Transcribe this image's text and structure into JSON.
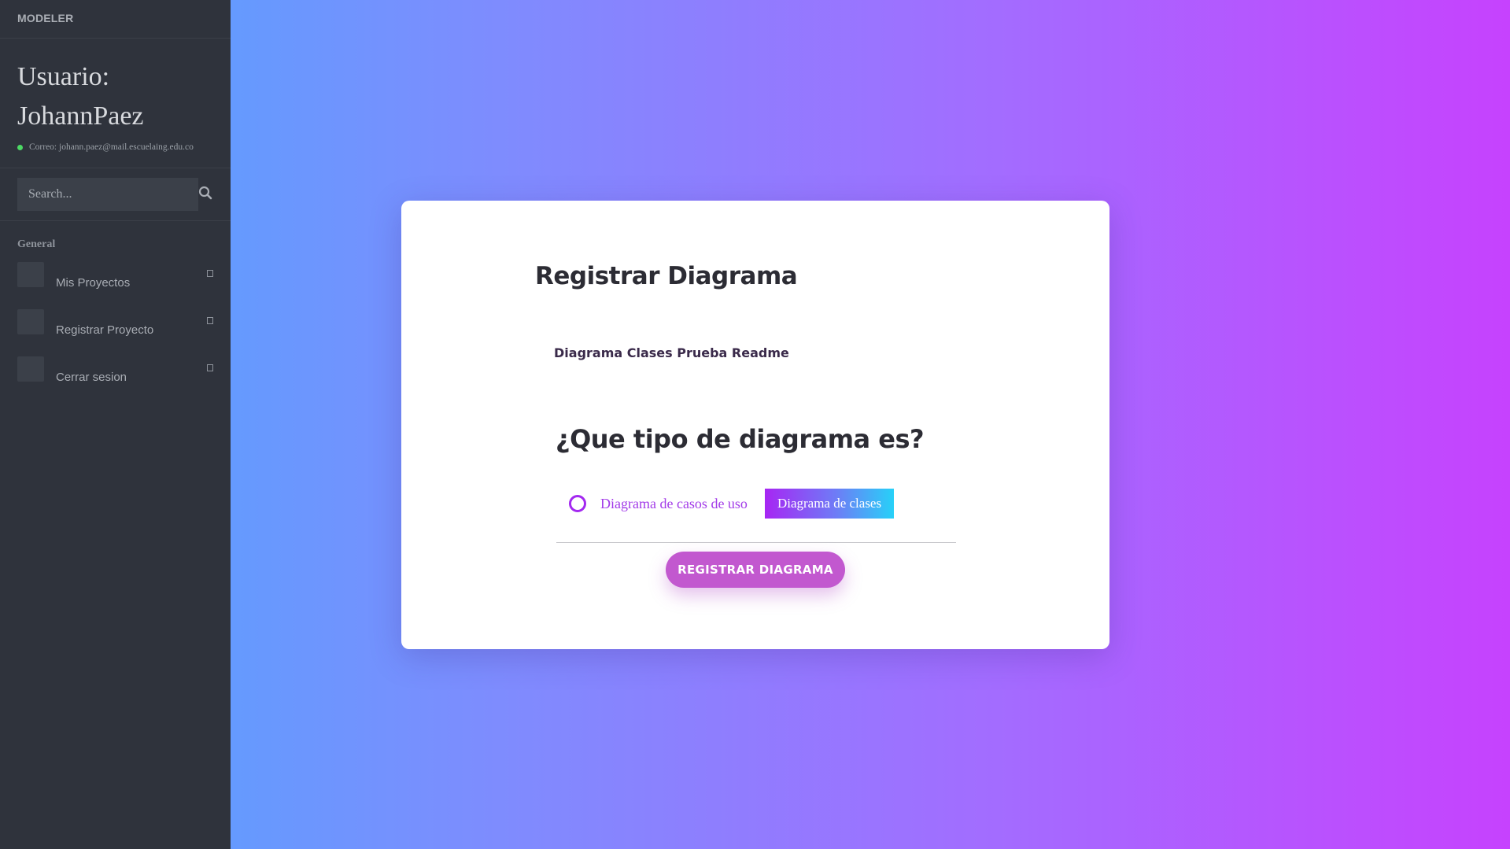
{
  "sidebar": {
    "brand": "MODELER",
    "user": {
      "label": "Usuario: JohannPaez",
      "email": "Correo: johann.paez@mail.escuelaing.edu.co",
      "status_color": "#4cd964"
    },
    "search": {
      "placeholder": "Search..."
    },
    "section_title": "General",
    "items": [
      {
        "label": "Mis Proyectos"
      },
      {
        "label": "Registrar Proyecto"
      },
      {
        "label": "Cerrar sesion"
      }
    ]
  },
  "form": {
    "title": "Registrar Diagrama",
    "diagram_name": "Diagrama Clases Prueba Readme",
    "question": "¿Que tipo de diagrama es?",
    "options": [
      {
        "label": "Diagrama de casos de uso",
        "selected": false
      },
      {
        "label": "Diagrama de clases",
        "selected": true
      }
    ],
    "submit_label": "REGISTRAR DIAGRAMA"
  },
  "colors": {
    "sidebar_bg": "#2f333c",
    "accent_purple": "#a329f0",
    "submit_bg": "#c258cf",
    "gradient_start": "#4fa6fe",
    "gradient_end": "#c642fe"
  }
}
